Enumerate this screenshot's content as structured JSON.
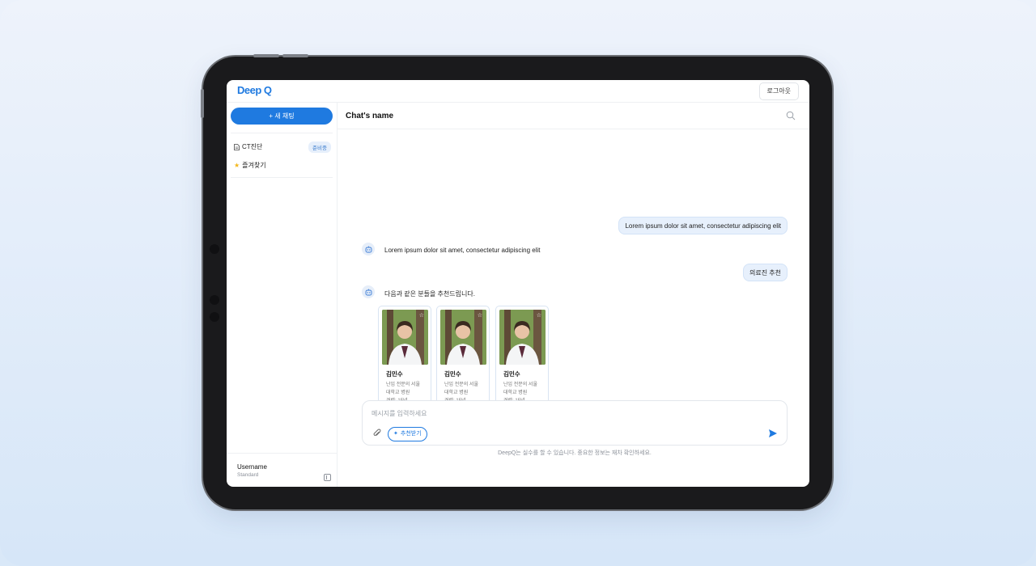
{
  "app": {
    "logo": "Deep Q",
    "logout_label": "로그아웃"
  },
  "sidebar": {
    "new_chat_label": "+ 새 채팅",
    "items": [
      {
        "label": "CT진단",
        "badge": "준비중",
        "icon": "document-icon"
      },
      {
        "label": "즐겨찾기",
        "icon": "star-icon"
      }
    ],
    "user": {
      "name": "Username",
      "plan": "Standard"
    }
  },
  "chat": {
    "title": "Chat's name",
    "messages": [
      {
        "role": "user",
        "text": "Lorem ipsum dolor sit amet, consectetur adipiscing elit"
      },
      {
        "role": "bot",
        "text": "Lorem ipsum dolor sit amet, consectetur adipiscing elit"
      },
      {
        "role": "user",
        "text": "의료진 추천"
      },
      {
        "role": "bot",
        "text": "다음과 같은 분들을 추천드립니다."
      }
    ],
    "doctors": [
      {
        "name": "김민수",
        "specialty": "난임 전문의 서울",
        "hospital": "대학교 병원",
        "experience": "경력: 15년"
      },
      {
        "name": "김민수",
        "specialty": "난임 전문의 서울",
        "hospital": "대학교 병원",
        "experience": "경력: 15년"
      },
      {
        "name": "김민수",
        "specialty": "난임 전문의 서울",
        "hospital": "대학교 병원",
        "experience": "경력: 15년"
      }
    ]
  },
  "composer": {
    "placeholder": "메시지를 입력하세요",
    "recommend_label": "추천받기",
    "disclaimer": "DeepQ는 실수를 할 수 있습니다. 중요한 정보는 재차 확인하세요."
  },
  "colors": {
    "accent": "#1f7ae0",
    "bubble": "#e7f0fc"
  }
}
